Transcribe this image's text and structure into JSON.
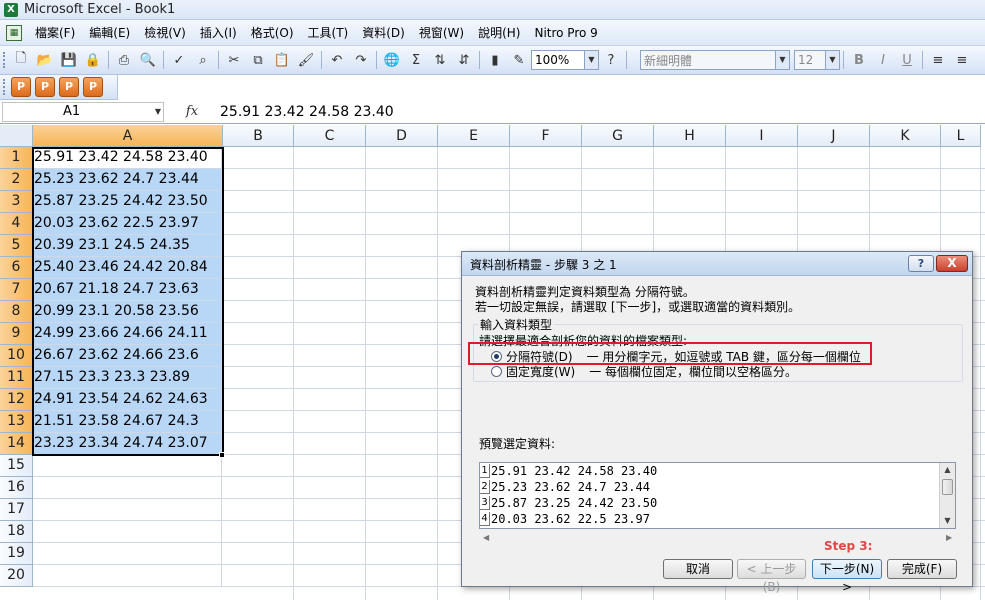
{
  "window": {
    "title": "Microsoft Excel - Book1"
  },
  "menu": [
    "檔案(F)",
    "編輯(E)",
    "檢視(V)",
    "插入(I)",
    "格式(O)",
    "工具(T)",
    "資料(D)",
    "視窗(W)",
    "說明(H)",
    "Nitro Pro 9"
  ],
  "toolbar": {
    "zoom": "100%",
    "font_name": "新細明體",
    "font_size": "12",
    "bold": "B",
    "italic": "I",
    "underline": "U"
  },
  "formula_bar": {
    "name_box": "A1",
    "fx": "fx",
    "content": "25.91 23.42 24.58 23.40"
  },
  "grid": {
    "columns": [
      "A",
      "B",
      "C",
      "D",
      "E",
      "F",
      "G",
      "H",
      "I",
      "J",
      "K",
      "L"
    ],
    "rows": [
      "1",
      "2",
      "3",
      "4",
      "5",
      "6",
      "7",
      "8",
      "9",
      "10",
      "11",
      "12",
      "13",
      "14",
      "15",
      "16",
      "17",
      "18",
      "19",
      "20"
    ],
    "cells_A": [
      "25.91 23.42 24.58 23.40",
      "25.23 23.62 24.7 23.44",
      "25.87 23.25 24.42 23.50",
      "20.03 23.62 22.5 23.97",
      "20.39 23.1 24.5 24.35",
      "25.40 23.46 24.42 20.84",
      "20.67 21.18 24.7 23.63",
      "20.99 23.1 20.58 23.56",
      "24.99 23.66 24.66 24.11",
      "26.67 23.62 24.66 23.6",
      "27.15 23.3 23.3 23.89",
      "24.91 23.54 24.62 24.63",
      "21.51 23.58 24.67 24.3",
      "23.23 23.34 24.74 23.07"
    ]
  },
  "dialog": {
    "title": "資料剖析精靈 - 步驟 3 之 1",
    "help": "?",
    "close": "X",
    "line1": "資料剖析精靈判定資料類型為 分隔符號。",
    "line2": "若一切設定無誤，請選取 [下一步]，或選取適當的資料類別。",
    "group_title": "輸入資料類型",
    "group_sub": "請選擇最適合剖析您的資料的檔案類型:",
    "option1_label": "分隔符號(D)",
    "option1_desc": "一 用分欄字元，如逗號或 TAB 鍵，區分每一個欄位",
    "option2_label": "固定寬度(W)",
    "option2_desc": "一 每個欄位固定，欄位間以空格區分。",
    "preview_label": "預覽選定資料:",
    "preview_rows": [
      {
        "n": "1",
        "text": "25.91 23.42 24.58 23.40"
      },
      {
        "n": "2",
        "text": "25.23 23.62 24.7 23.44"
      },
      {
        "n": "3",
        "text": "25.87 23.25 24.42 23.50"
      },
      {
        "n": "4",
        "text": "20.03 23.62 22.5 23.97"
      }
    ],
    "step_note": "Step 3:",
    "buttons": {
      "cancel": "取消",
      "back": "< 上一步(B)",
      "next": "下一步(N) >",
      "finish": "完成(F)"
    }
  },
  "colors": {
    "selection": "#b8d6f5",
    "header_selected": "#f7b556",
    "highlight_box": "#e11a2b",
    "step_note": "#e04848"
  }
}
